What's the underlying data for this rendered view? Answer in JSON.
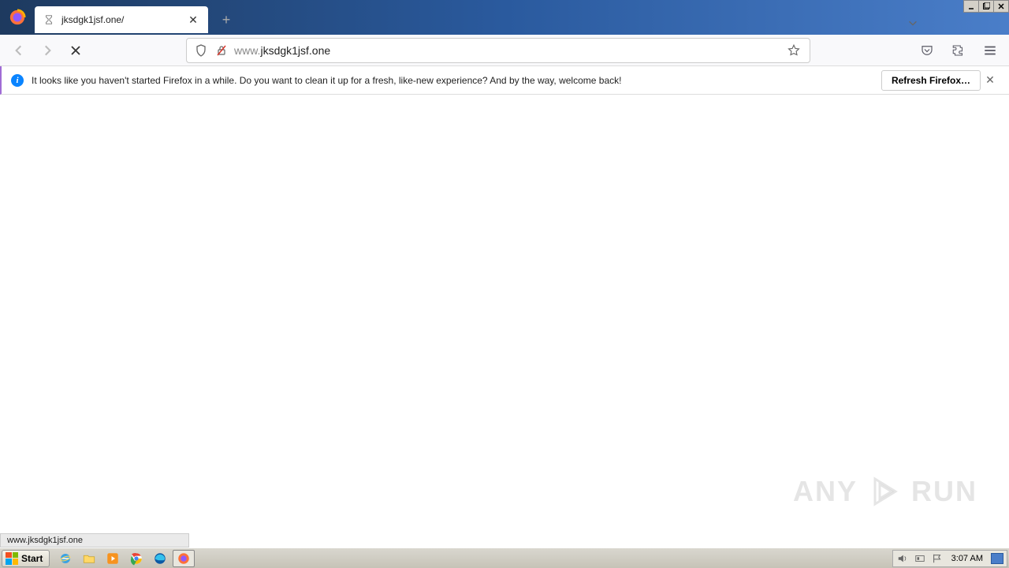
{
  "tab": {
    "title": "jksdgk1jsf.one/"
  },
  "url": {
    "prefix": "www.",
    "domain": "jksdgk1jsf.one"
  },
  "notification": {
    "text": "It looks like you haven't started Firefox in a while. Do you want to clean it up for a fresh, like-new experience? And by the way, welcome back!",
    "button": "Refresh Firefox…"
  },
  "status": "www.jksdgk1jsf.one",
  "watermark": {
    "left": "ANY",
    "right": "RUN"
  },
  "taskbar": {
    "start": "Start",
    "time": "3:07 AM"
  }
}
